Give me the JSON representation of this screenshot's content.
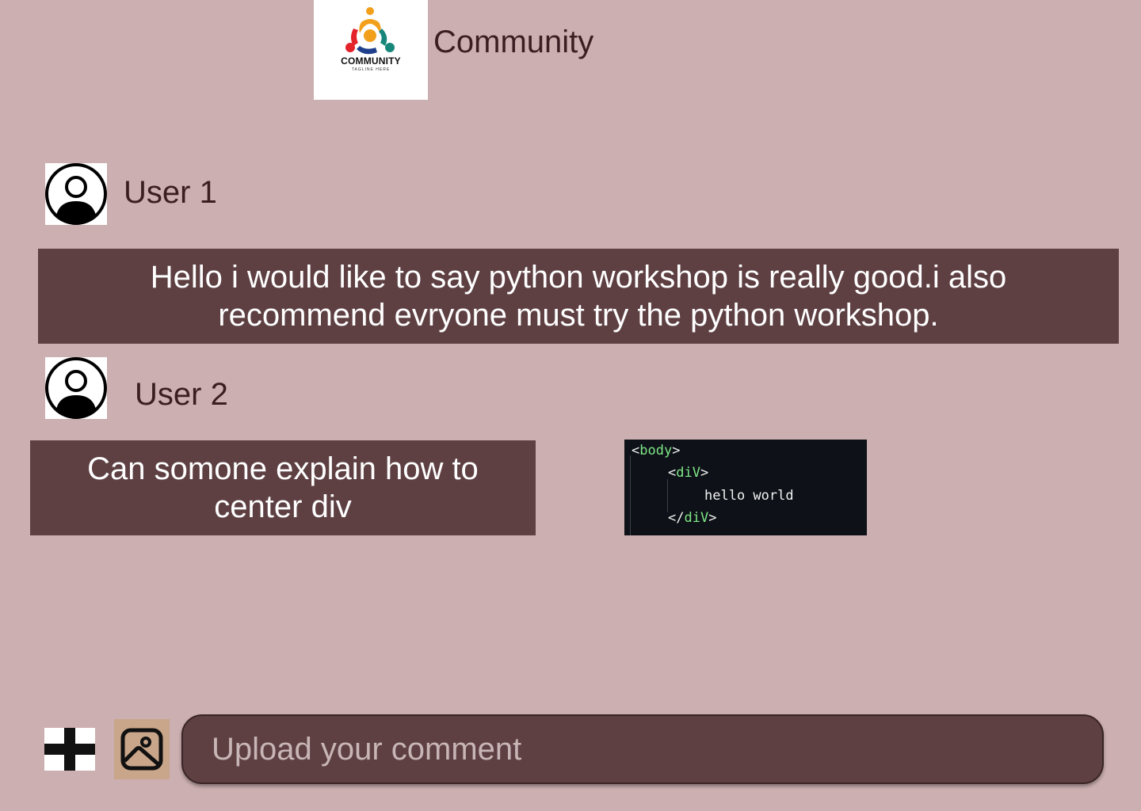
{
  "header": {
    "title": "Community",
    "logo": {
      "icon": "community-logo-icon",
      "word": "COMMUNITY",
      "tagline": "TAGLINE HERE"
    }
  },
  "posts": [
    {
      "user": "User 1",
      "avatar_icon": "user-avatar-icon",
      "message": "Hello i would like to say python workshop is really good.i also recommend evryone must try the python workshop."
    },
    {
      "user": "User 2",
      "avatar_icon": "user-avatar-icon",
      "message": "Can somone explain how to center div",
      "attachment": {
        "type": "code-screenshot",
        "lines": [
          {
            "open": "<",
            "tag": "body",
            "close": ">"
          },
          {
            "open": "<",
            "tag": "diV",
            "close": ">"
          },
          {
            "text": "hello world"
          },
          {
            "open": "</",
            "tag": "diV",
            "close": ">"
          }
        ]
      }
    }
  ],
  "composer": {
    "placeholder": "Upload your comment",
    "add_icon": "plus-icon",
    "image_icon": "image-icon"
  },
  "colors": {
    "background": "#ccafb0",
    "bubble": "#5e4043",
    "text_dark": "#3a1f22",
    "image_button": "#c9a58a",
    "code_background": "#0e1117",
    "code_tag": "#7ee787"
  }
}
